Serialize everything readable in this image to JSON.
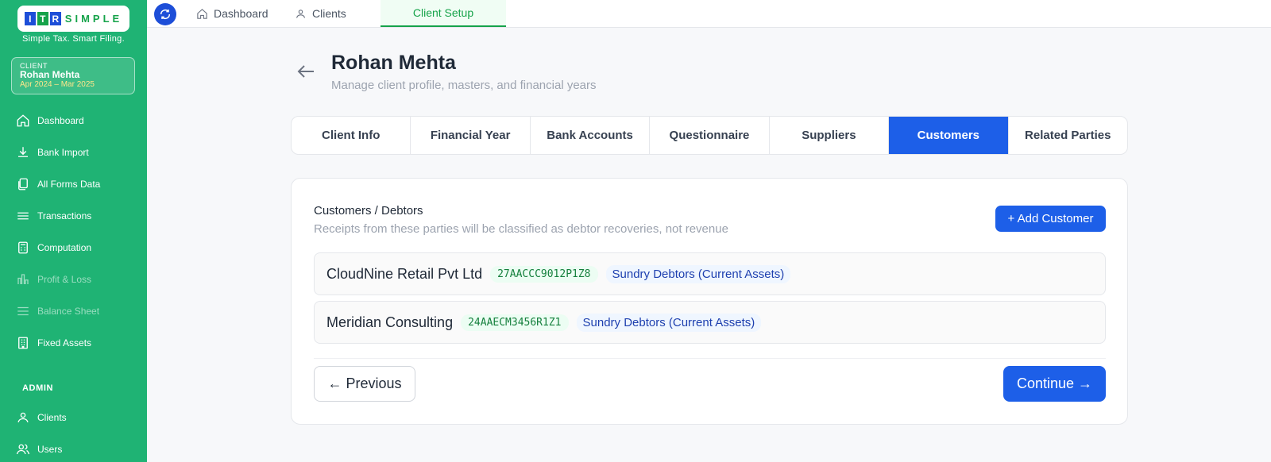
{
  "sidebar": {
    "logo": {
      "letters": [
        "I",
        "T",
        "R"
      ],
      "word": "SIMPLE"
    },
    "tagline": "Simple Tax. Smart Filing.",
    "client_card": {
      "label": "CLIENT",
      "name": "Rohan Mehta",
      "period": "Apr 2024 – Mar 2025"
    },
    "nav": [
      {
        "label": "Dashboard",
        "icon": "home-icon"
      },
      {
        "label": "Bank Import",
        "icon": "download-icon"
      },
      {
        "label": "All Forms Data",
        "icon": "documents-icon"
      },
      {
        "label": "Transactions",
        "icon": "list-icon"
      },
      {
        "label": "Computation",
        "icon": "calculator-icon"
      },
      {
        "label": "Profit & Loss",
        "icon": "bar-chart-icon",
        "disabled": true
      },
      {
        "label": "Balance Sheet",
        "icon": "lines-icon",
        "disabled": true
      },
      {
        "label": "Fixed Assets",
        "icon": "building-icon"
      }
    ],
    "admin_label": "ADMIN",
    "admin_nav": [
      {
        "label": "Clients",
        "icon": "clients-icon"
      },
      {
        "label": "Users",
        "icon": "users-icon"
      }
    ]
  },
  "topbar": {
    "tabs": [
      {
        "label": "Dashboard",
        "icon": "home-icon"
      },
      {
        "label": "Clients",
        "icon": "clients-icon"
      },
      {
        "label": "Client Setup",
        "active": true
      }
    ]
  },
  "header": {
    "title": "Rohan Mehta",
    "subtitle": "Manage client profile, masters, and financial years"
  },
  "tabs": [
    "Client Info",
    "Financial Year",
    "Bank Accounts",
    "Questionnaire",
    "Suppliers",
    "Customers",
    "Related Parties"
  ],
  "active_tab": "Customers",
  "customers": {
    "title": "Customers / Debtors",
    "subtitle": "Receipts from these parties will be classified as debtor recoveries, not revenue",
    "add_label": "+ Add Customer",
    "rows": [
      {
        "name": "CloudNine Retail Pvt Ltd",
        "gstin": "27AACCC9012P1Z8",
        "group": "Sundry Debtors (Current Assets)"
      },
      {
        "name": "Meridian Consulting",
        "gstin": "24AAECM3456R1Z1",
        "group": "Sundry Debtors (Current Assets)"
      }
    ],
    "previous_label": "← Previous",
    "continue_label": "Continue →"
  },
  "colors": {
    "sidebar": "#1fb374",
    "primary": "#1d5fe8",
    "accent_green": "#16a34a"
  }
}
